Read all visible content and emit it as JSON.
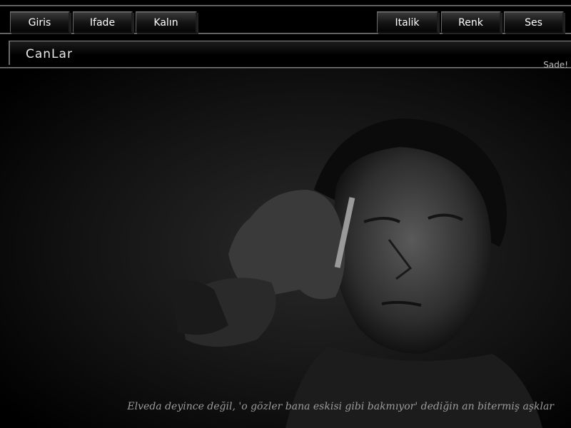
{
  "nav": {
    "left": [
      "Giris",
      "Ifade",
      "Kalın"
    ],
    "right": [
      "Italik",
      "Renk",
      "Ses"
    ]
  },
  "header": {
    "title": "CanLar",
    "sade_link": "Sade!"
  },
  "quote": "Elveda deyince değil, 'o gözler bana eskisi gibi bakmıyor' dediğin an bitermiş aşklar",
  "colors": {
    "background": "#000000",
    "button_text": "#ffffff",
    "quote_text": "#9c9c9c"
  }
}
